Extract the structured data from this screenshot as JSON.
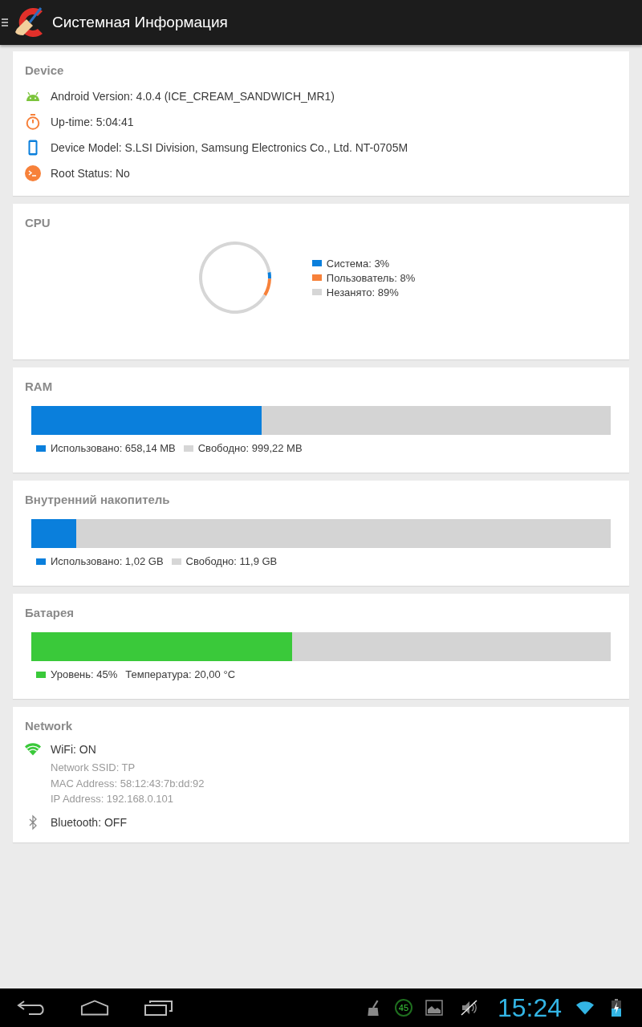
{
  "app_bar": {
    "title": "Системная Информация"
  },
  "device": {
    "title": "Device",
    "rows": [
      {
        "kind": "android",
        "text": "Android Version: 4.0.4 (ICE_CREAM_SANDWICH_MR1)"
      },
      {
        "kind": "timer",
        "text": "Up-time: 5:04:41"
      },
      {
        "kind": "phone",
        "text": "Device Model: S.LSI Division, Samsung Electronics Co., Ltd. NT-0705M"
      },
      {
        "kind": "terminal",
        "text": "Root Status: No"
      }
    ]
  },
  "cpu": {
    "title": "CPU",
    "chart_data": {
      "type": "donut",
      "categories": [
        "Система: 3%",
        "Пользователь: 8%",
        "Незанято: 89%"
      ],
      "series": [
        {
          "values": [
            3,
            8,
            89
          ]
        }
      ]
    },
    "legend": [
      {
        "color": "#0a7fdc"
      },
      {
        "color": "#f7813a"
      },
      {
        "color": "#d6d6d6"
      }
    ]
  },
  "meters": [
    {
      "title": "RAM",
      "level": 0.397,
      "color": "#0a7fdc",
      "legend": [
        {
          "label": "Использовано: 658,14 MB",
          "color": "#0a7fdc"
        },
        {
          "label": "Свободно: 999,22 MB",
          "color": "#d6d6d6"
        }
      ]
    },
    {
      "title": "Внутренний накопитель",
      "level": 0.078,
      "color": "#0a7fdc",
      "legend": [
        {
          "label": "Использовано: 1,02 GB",
          "color": "#0a7fdc"
        },
        {
          "label": "Свободно: 11,9 GB",
          "color": "#d6d6d6"
        }
      ]
    },
    {
      "title": "Батарея",
      "level": 0.45,
      "color": "#3ac93a",
      "legend": [
        {
          "label": "Уровень: 45%",
          "color": "#3ac93a"
        },
        {
          "label": "Температура: 20,00 °C"
        }
      ]
    }
  ],
  "network": {
    "title": "Network",
    "rows": [
      {
        "kind": "wifi",
        "text": "WiFi: ON",
        "details": [
          "Network SSID: TP",
          "MAC Address: 58:12:43:7b:dd:92",
          "IP Address: 192.168.0.101"
        ]
      },
      {
        "kind": "bluetooth",
        "text": "Bluetooth: OFF"
      }
    ]
  },
  "system_bar": {
    "notification_badge": "45",
    "time": "15:24"
  }
}
